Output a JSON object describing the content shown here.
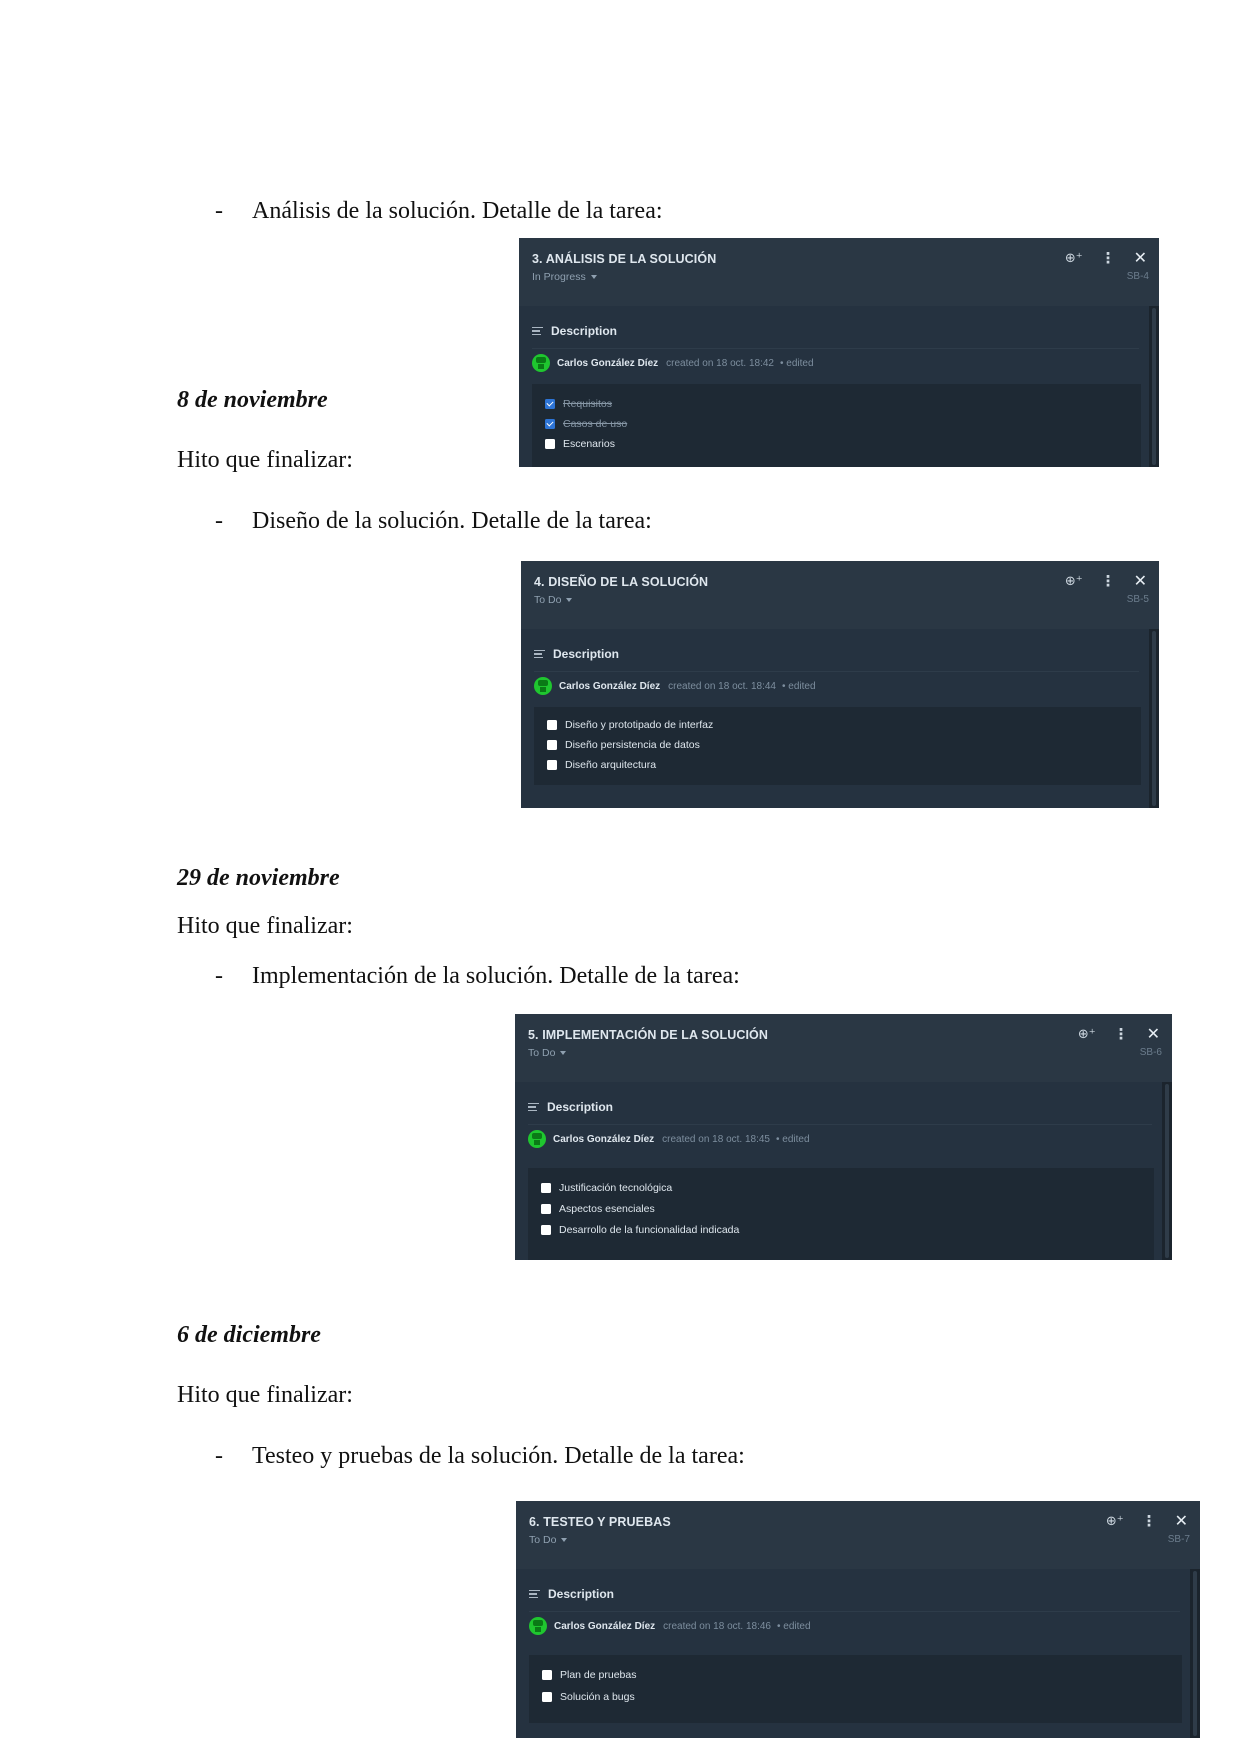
{
  "document": {
    "bullets": [
      {
        "dash": "-",
        "text": "Análisis de la solución. Detalle de la tarea:"
      },
      {
        "dash": "-",
        "text": "Diseño de la solución. Detalle de la tarea:"
      },
      {
        "dash": "-",
        "text": "Implementación de la solución. Detalle de la tarea:"
      },
      {
        "dash": "-",
        "text": "Testeo y pruebas de la solución. Detalle de la tarea:"
      }
    ],
    "dates": [
      "8 de noviembre",
      "29 de noviembre",
      "6 de diciembre"
    ],
    "hito_label": "Hito que finalizar:"
  },
  "cards": [
    {
      "title": "3. ANÁLISIS DE LA SOLUCIÓN",
      "status": "In Progress",
      "key": "SB-4",
      "description_label": "Description",
      "author": "Carlos González Díez",
      "created": "created on 18 oct. 18:42",
      "edited": "• edited",
      "items": [
        {
          "label": "Requisitos",
          "checked": true
        },
        {
          "label": "Casos de uso",
          "checked": true
        },
        {
          "label": "Escenarios",
          "checked": false
        }
      ]
    },
    {
      "title": "4. DISEÑO DE LA SOLUCIÓN",
      "status": "To Do",
      "key": "SB-5",
      "description_label": "Description",
      "author": "Carlos González Díez",
      "created": "created on 18 oct. 18:44",
      "edited": "• edited",
      "items": [
        {
          "label": "Diseño y prototipado de interfaz",
          "checked": false
        },
        {
          "label": "Diseño persistencia de datos",
          "checked": false
        },
        {
          "label": "Diseño arquitectura",
          "checked": false
        }
      ]
    },
    {
      "title": "5. IMPLEMENTACIÓN DE LA SOLUCIÓN",
      "status": "To Do",
      "key": "SB-6",
      "description_label": "Description",
      "author": "Carlos González Díez",
      "created": "created on 18 oct. 18:45",
      "edited": "• edited",
      "items": [
        {
          "label": "Justificación tecnológica",
          "checked": false
        },
        {
          "label": "Aspectos esenciales",
          "checked": false
        },
        {
          "label": "Desarrollo de la funcionalidad indicada",
          "checked": false
        }
      ]
    },
    {
      "title": "6. TESTEO Y PRUEBAS",
      "status": "To Do",
      "key": "SB-7",
      "description_label": "Description",
      "author": "Carlos González Díez",
      "created": "created on 18 oct. 18:46",
      "edited": "• edited",
      "items": [
        {
          "label": "Plan de pruebas",
          "checked": false
        },
        {
          "label": "Solución a bugs",
          "checked": false
        }
      ]
    }
  ],
  "icons": {
    "watch": "watch-icon",
    "more": "more-options-icon",
    "close": "close-icon",
    "description": "description-icon",
    "status_caret": "chevron-down-icon"
  },
  "colors": {
    "card_bg": "#1d2630",
    "card_header": "#2a3744",
    "avatar": "#1fc62f",
    "checkbox_checked": "#2d74d6"
  }
}
